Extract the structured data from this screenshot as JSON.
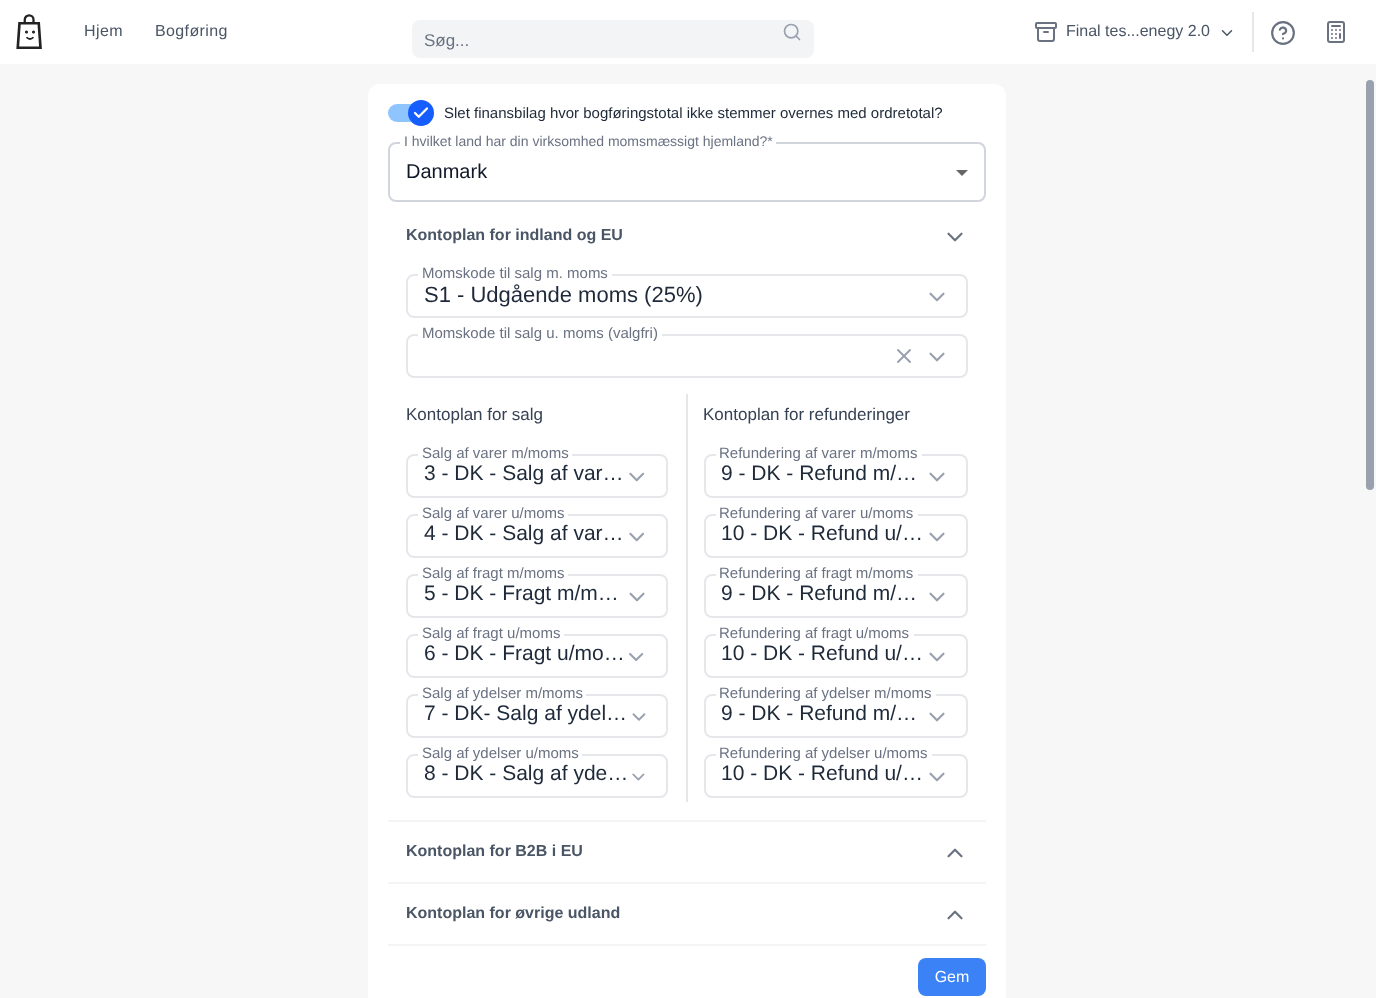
{
  "nav": {
    "links": [
      "Hjem",
      "Bogføring"
    ],
    "search": {
      "placeholder": "Søg..."
    },
    "company": "Final tes...enegy 2.0"
  },
  "toggle": {
    "on": true,
    "label": "Slet finansbilag hvor bogføringstotal ikke stemmer overnes med ordretotal?"
  },
  "country": {
    "label": "I hvilket land har din virksomhed momsmæssigt hjemland?*",
    "value": "Danmark"
  },
  "sections": [
    {
      "title": "Kontoplan for indland og EU",
      "expanded": true,
      "vat_fields": [
        {
          "label": "Momskode til salg m. moms",
          "value": "S1 - Udgående moms (25%)",
          "clearable": false
        },
        {
          "label": "Momskode til salg u. moms (valgfri)",
          "clearable": true
        }
      ],
      "columns": [
        {
          "title": "Kontoplan for salg",
          "fields": [
            {
              "label": "Salg af varer m/moms",
              "value": "3 - DK - Salg af var…"
            },
            {
              "label": "Salg af varer u/moms",
              "value": "4 - DK - Salg af var…"
            },
            {
              "label": "Salg af fragt m/moms",
              "value": "5 - DK - Fragt m/m…"
            },
            {
              "label": "Salg af fragt u/moms",
              "value": "6 - DK - Fragt u/mo…"
            },
            {
              "label": "Salg af ydelser m/moms",
              "value": "7 - DK- Salg af ydel…"
            },
            {
              "label": "Salg af ydelser u/moms",
              "value": "8 - DK - Salg af yde…"
            }
          ]
        },
        {
          "title": "Kontoplan for refunderinger",
          "fields": [
            {
              "label": "Refundering af varer m/moms",
              "value": "9 - DK - Refund m/…"
            },
            {
              "label": "Refundering af varer u/moms",
              "value": "10 - DK - Refund u/…"
            },
            {
              "label": "Refundering af fragt m/moms",
              "value": "9 - DK - Refund m/…"
            },
            {
              "label": "Refundering af fragt u/moms",
              "value": "10 - DK - Refund u/…"
            },
            {
              "label": "Refundering af ydelser m/moms",
              "value": "9 - DK - Refund m/…"
            },
            {
              "label": "Refundering af ydelser u/moms",
              "value": "10 - DK - Refund u/…"
            }
          ]
        }
      ]
    },
    {
      "title": "Kontoplan for B2B i EU",
      "expanded": false
    },
    {
      "title": "Kontoplan for øvrige udland",
      "expanded": false
    }
  ],
  "save_button": "Gem"
}
